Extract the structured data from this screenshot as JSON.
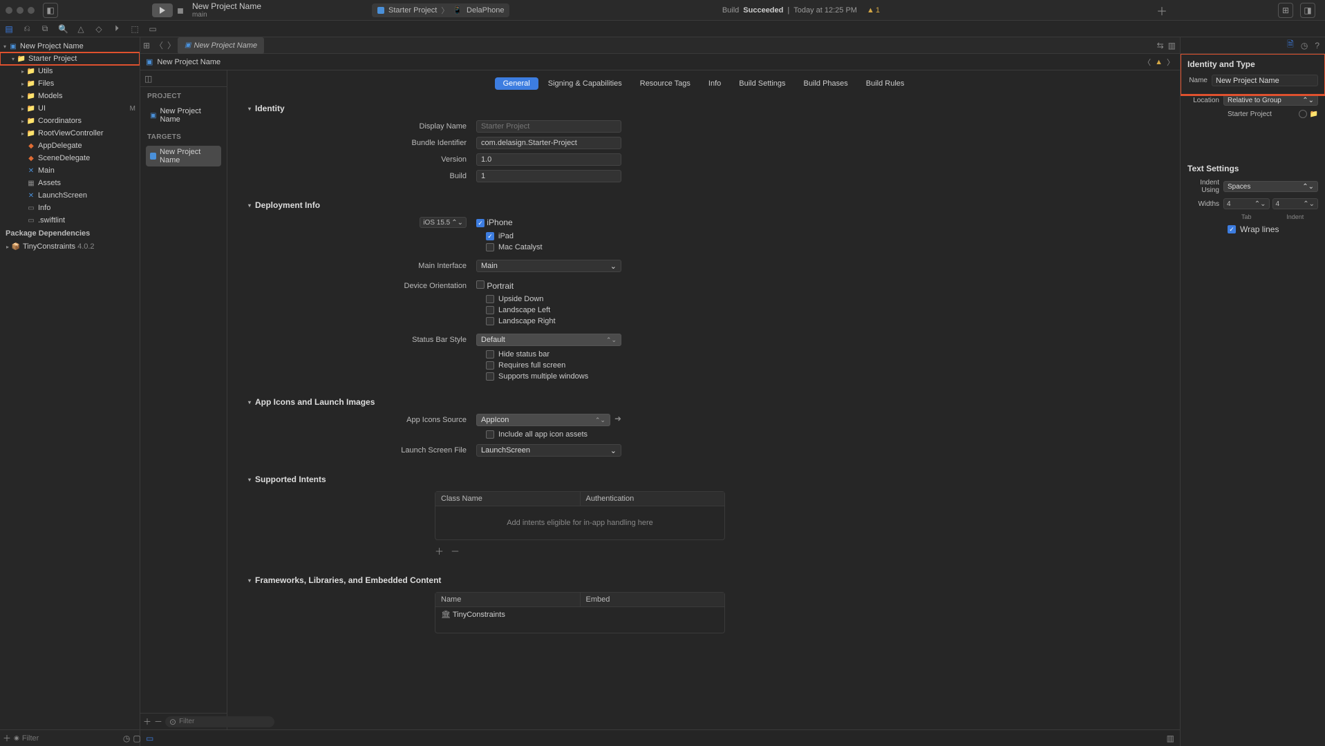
{
  "titlebar": {
    "project_name": "New Project Name",
    "branch": "main",
    "scheme": "Starter Project",
    "device": "DelaPhone",
    "build_status": "Build",
    "build_result": "Succeeded",
    "build_sep": " | ",
    "build_time": "Today at 12:25 PM",
    "warning_count": "1"
  },
  "nav_filter_placeholder": "Filter",
  "navigator": {
    "root": "New Project Name",
    "selected": "Starter Project",
    "folders": [
      "Utils",
      "Files",
      "Models",
      "UI",
      "Coordinators",
      "RootViewController"
    ],
    "ui_status": "M",
    "items": [
      "AppDelegate",
      "SceneDelegate",
      "Main",
      "Assets",
      "LaunchScreen",
      "Info",
      ".swiftlint"
    ],
    "dep_header": "Package Dependencies",
    "dep_name": "TinyConstraints",
    "dep_version": "4.0.2"
  },
  "tabs": {
    "active": "New Project Name"
  },
  "jumpbar": {
    "item": "New Project Name"
  },
  "outline": {
    "project_header": "PROJECT",
    "project_item": "New Project Name",
    "targets_header": "TARGETS",
    "target_item": "New Project Name",
    "filter_placeholder": "Filter"
  },
  "stabs": [
    "General",
    "Signing & Capabilities",
    "Resource Tags",
    "Info",
    "Build Settings",
    "Build Phases",
    "Build Rules"
  ],
  "sections": {
    "identity": {
      "title": "Identity",
      "display_name_label": "Display Name",
      "display_name_placeholder": "Starter Project",
      "bundle_id_label": "Bundle Identifier",
      "bundle_id": "com.delasign.Starter-Project",
      "version_label": "Version",
      "version": "1.0",
      "build_label": "Build",
      "build": "1"
    },
    "deployment": {
      "title": "Deployment Info",
      "target_label": "iOS 15.5",
      "devices": [
        "iPhone",
        "iPad",
        "Mac Catalyst"
      ],
      "devices_checked": [
        true,
        true,
        false
      ],
      "main_interface_label": "Main Interface",
      "main_interface": "Main",
      "orientation_label": "Device Orientation",
      "orientations": [
        "Portrait",
        "Upside Down",
        "Landscape Left",
        "Landscape Right"
      ],
      "status_bar_label": "Status Bar Style",
      "status_bar_value": "Default",
      "status_bar_opts": [
        "Hide status bar",
        "Requires full screen",
        "Supports multiple windows"
      ]
    },
    "appicons": {
      "title": "App Icons and Launch Images",
      "source_label": "App Icons Source",
      "source_value": "AppIcon",
      "include_all": "Include all app icon assets",
      "launch_label": "Launch Screen File",
      "launch_value": "LaunchScreen"
    },
    "intents": {
      "title": "Supported Intents",
      "col1": "Class Name",
      "col2": "Authentication",
      "empty": "Add intents eligible for in-app handling here"
    },
    "frameworks": {
      "title": "Frameworks, Libraries, and Embedded Content",
      "col1": "Name",
      "col2": "Embed",
      "item": "TinyConstraints"
    }
  },
  "inspector": {
    "title": "Identity and Type",
    "name_label": "Name",
    "name_value": "New Project Name",
    "location_label": "Location",
    "location_value": "Relative to Group",
    "location_path": "Starter Project",
    "text_settings": "Text Settings",
    "indent_label": "Indent Using",
    "indent_value": "Spaces",
    "widths_label": "Widths",
    "tab_width": "4",
    "indent_width": "4",
    "tab_hint": "Tab",
    "indent_hint": "Indent",
    "wrap": "Wrap lines"
  }
}
